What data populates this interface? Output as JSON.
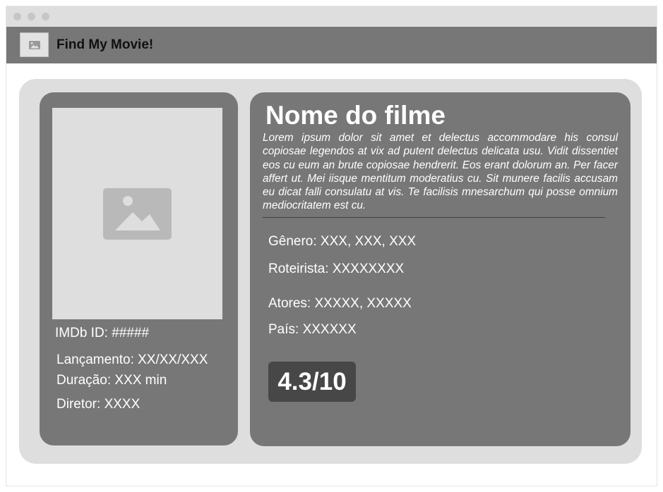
{
  "app": {
    "title": "Find My Movie!",
    "logo_icon": "image-placeholder-icon"
  },
  "poster": {
    "icon": "image-placeholder-icon"
  },
  "details_left": {
    "imdb": "IMDb ID: #####",
    "release": "Lançamento: XX/XX/XXX",
    "duration": "Duração: XXX min",
    "director": "Diretor: XXXX"
  },
  "movie": {
    "title": "Nome do filme",
    "synopsis": "Lorem ipsum dolor sit amet et delectus accommodare his consul copiosae legendos at vix ad putent delectus delicata usu. Vidit dissentiet eos cu eum an brute copiosae hendrerit. Eos erant dolorum an. Per facer affert ut. Mei iisque mentitum moderatius cu. Sit munere facilis accusam eu dicat falli consulatu at vis. Te facilisis mnesarchum qui posse omnium mediocritatem est cu.",
    "genre": "Gênero: XXX, XXX, XXX",
    "writer": "Roteirista: XXXXXXXX",
    "actors": "Atores: XXXXX, XXXXX",
    "country": "País: XXXXXX",
    "rating": "4.3/10"
  },
  "colors": {
    "navbar": "#777777",
    "card": "#777777",
    "outer_card": "#dedede",
    "rating_bg": "#474747"
  }
}
